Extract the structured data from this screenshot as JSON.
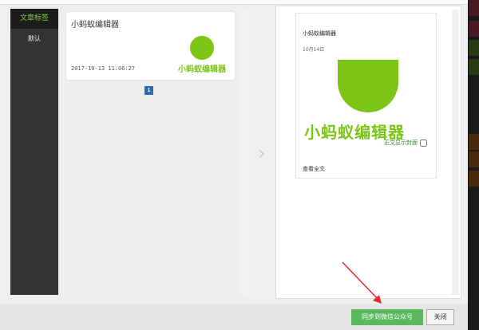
{
  "sidebar": {
    "header": "文章标签",
    "items": [
      {
        "label": "默认"
      }
    ]
  },
  "card": {
    "title": "小蚂蚁编辑器",
    "date": "2017-10-13 11:06:27",
    "logo_text": "小蚂蚁编辑器"
  },
  "pagination": {
    "current": "1"
  },
  "preview": {
    "title": "小蚂蚁编辑器",
    "date": "10月14日",
    "logo_text": "小蚂蚁编辑器",
    "cover_label": "正文显示封面",
    "read_more": "查看全文"
  },
  "footer": {
    "sync_button": "同步到微信公众号",
    "close_button": "关闭"
  },
  "colors": {
    "accent": "#7cc516",
    "primary_button": "#5cb85c",
    "page_active": "#2d6db5"
  }
}
